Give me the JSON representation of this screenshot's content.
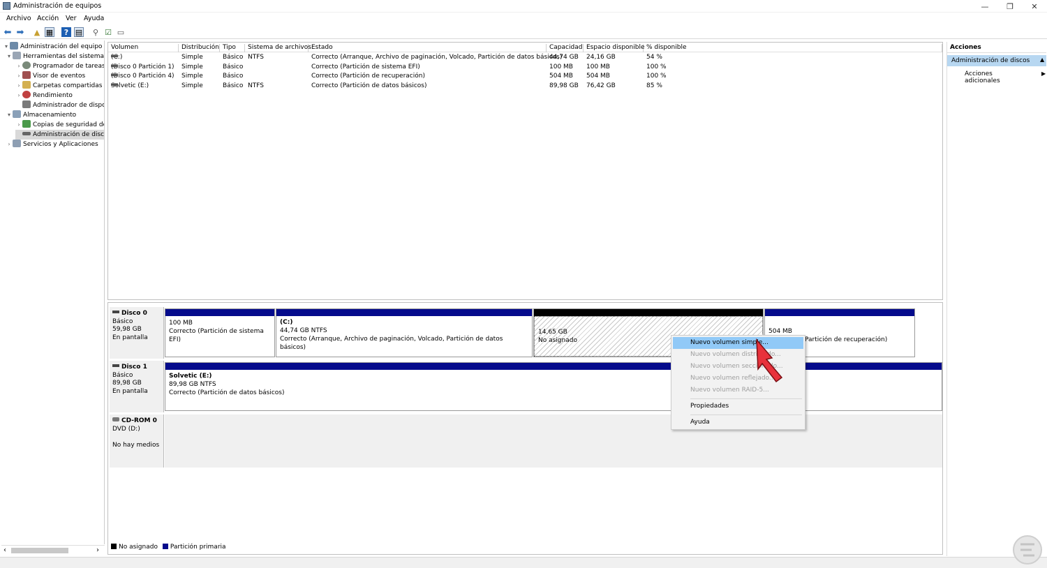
{
  "window": {
    "title": "Administración de equipos"
  },
  "menu": [
    "Archivo",
    "Acción",
    "Ver",
    "Ayuda"
  ],
  "tree": [
    {
      "label": "Administración del equipo (loc",
      "level": 0,
      "expand": "▾"
    },
    {
      "label": "Herramientas del sistema",
      "level": 1,
      "expand": "▾"
    },
    {
      "label": "Programador de tareas",
      "level": 2,
      "expand": "›"
    },
    {
      "label": "Visor de eventos",
      "level": 2,
      "expand": "›"
    },
    {
      "label": "Carpetas compartidas",
      "level": 2,
      "expand": "›"
    },
    {
      "label": "Rendimiento",
      "level": 2,
      "expand": "›"
    },
    {
      "label": "Administrador de dispo",
      "level": 2,
      "expand": ""
    },
    {
      "label": "Almacenamiento",
      "level": 1,
      "expand": "▾"
    },
    {
      "label": "Copias de seguridad de",
      "level": 2,
      "expand": "›"
    },
    {
      "label": "Administración de disco",
      "level": 2,
      "expand": ""
    },
    {
      "label": "Servicios y Aplicaciones",
      "level": 1,
      "expand": "›"
    }
  ],
  "volume_list": {
    "columns": [
      "Volumen",
      "Distribución",
      "Tipo",
      "Sistema de archivos",
      "Estado",
      "Capacidad",
      "Espacio disponible",
      "% disponible"
    ],
    "rows": [
      [
        "(C:)",
        "Simple",
        "Básico",
        "NTFS",
        "Correcto (Arranque, Archivo de paginación, Volcado, Partición de datos básicos)",
        "44,74 GB",
        "24,16 GB",
        "54 %"
      ],
      [
        "(Disco 0 Partición 1)",
        "Simple",
        "Básico",
        "",
        "Correcto (Partición de sistema EFI)",
        "100 MB",
        "100 MB",
        "100 %"
      ],
      [
        "(Disco 0 Partición 4)",
        "Simple",
        "Básico",
        "",
        "Correcto (Partición de recuperación)",
        "504 MB",
        "504 MB",
        "100 %"
      ],
      [
        "Solvetic (E:)",
        "Simple",
        "Básico",
        "NTFS",
        "Correcto (Partición de datos básicos)",
        "89,98 GB",
        "76,42 GB",
        "85 %"
      ]
    ]
  },
  "disks": [
    {
      "name": "Disco 0",
      "type": "Básico",
      "size": "59,98 GB",
      "state": "En pantalla"
    },
    {
      "name": "Disco 1",
      "type": "Básico",
      "size": "89,98 GB",
      "state": "En pantalla"
    },
    {
      "name": "CD-ROM 0",
      "type": "DVD (D:)",
      "size": "",
      "state": "No hay medios"
    }
  ],
  "partitions": {
    "d0p1": {
      "title": "",
      "line1": "100 MB",
      "line2": "Correcto (Partición de sistema EFI)"
    },
    "d0c": {
      "title": "(C:)",
      "line1": "44,74 GB NTFS",
      "line2": "Correcto (Arranque, Archivo de paginación, Volcado, Partición de datos básicos)"
    },
    "d0u": {
      "title": "",
      "line1": "14,65 GB",
      "line2": "No asignado"
    },
    "d0r": {
      "title": "",
      "line1": "504 MB",
      "line2": "Partición de recuperación)"
    },
    "d1e": {
      "title": "Solvetic  (E:)",
      "line1": "89,98 GB NTFS",
      "line2": "Correcto (Partición de datos básicos)"
    }
  },
  "legend": {
    "unallocated": "No asignado",
    "primary": "Partición primaria"
  },
  "actions": {
    "header": "Acciones",
    "section": "Administración de discos",
    "more": "Acciones adicionales"
  },
  "context_menu": {
    "items": [
      {
        "label": "Nuevo volumen simple...",
        "enabled": true
      },
      {
        "label": "Nuevo volumen distribuido...",
        "enabled": false
      },
      {
        "label": "Nuevo volumen seccionado...",
        "enabled": false
      },
      {
        "label": "Nuevo volumen reflejado...",
        "enabled": false
      },
      {
        "label": "Nuevo volumen RAID-5...",
        "enabled": false
      }
    ],
    "properties": "Propiedades",
    "help": "Ayuda"
  },
  "colors": {
    "primary_partition": "#050b8c",
    "highlight": "#91c9f7",
    "selected_action": "#b7d7f1",
    "pointer": "#e8323c"
  }
}
